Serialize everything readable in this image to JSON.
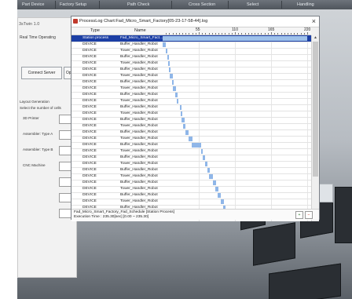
{
  "topbar": {
    "tabs": [
      "Part Device",
      "Factory Setup",
      "Path Check",
      "Cross Section",
      "Select",
      "Handling"
    ]
  },
  "left_panel": {
    "title": "3sTwin 1.0",
    "section_realtime": "Real Time Operating",
    "connect_button": "Connect Server",
    "open_button": "Open",
    "section_layout": "Layout Generation",
    "select_cells": "Select the number of cells",
    "cells": [
      {
        "label": "3D Printer"
      },
      {
        "label": "Assembler: Type A"
      },
      {
        "label": "Assembler: Type B"
      },
      {
        "label": "CNC Machine"
      }
    ]
  },
  "window": {
    "title": "ProcessLog Chart:Fad_Micro_Smart_Factory[05-23-17-58-44].log",
    "close": "×",
    "col_type": "Type",
    "col_name": "Name",
    "ticks": [
      "55",
      "110",
      "165",
      "220"
    ],
    "rows": [
      {
        "type": "Station process",
        "name": "Fad_Micro_Smart_Fact...",
        "selected": true,
        "start": 0,
        "dur": 220
      },
      {
        "type": "DEVICE",
        "name": "Buffer_Handler_Robot",
        "start": 0,
        "dur": 5
      },
      {
        "type": "DEVICE",
        "name": "Tower_Handler_Robot",
        "start": 5,
        "dur": 2
      },
      {
        "type": "DEVICE",
        "name": "Buffer_Handler_Robot",
        "start": 7,
        "dur": 2
      },
      {
        "type": "DEVICE",
        "name": "Tower_Handler_Robot",
        "start": 8,
        "dur": 2
      },
      {
        "type": "DEVICE",
        "name": "Buffer_Handler_Robot",
        "start": 10,
        "dur": 2
      },
      {
        "type": "DEVICE",
        "name": "Tower_Handler_Robot",
        "start": 11,
        "dur": 4
      },
      {
        "type": "DEVICE",
        "name": "Buffer_Handler_Robot",
        "start": 14,
        "dur": 2
      },
      {
        "type": "DEVICE",
        "name": "Tower_Handler_Robot",
        "start": 16,
        "dur": 4
      },
      {
        "type": "DEVICE",
        "name": "Buffer_Handler_Robot",
        "start": 19,
        "dur": 4
      },
      {
        "type": "DEVICE",
        "name": "Tower_Handler_Robot",
        "start": 22,
        "dur": 1
      },
      {
        "type": "DEVICE",
        "name": "Buffer_Handler_Robot",
        "start": 26,
        "dur": 1
      },
      {
        "type": "DEVICE",
        "name": "Tower_Handler_Robot",
        "start": 27,
        "dur": 3
      },
      {
        "type": "DEVICE",
        "name": "Buffer_Handler_Robot",
        "start": 29,
        "dur": 4
      },
      {
        "type": "DEVICE",
        "name": "Tower_Handler_Robot",
        "start": 31,
        "dur": 4
      },
      {
        "type": "DEVICE",
        "name": "Buffer_Handler_Robot",
        "start": 35,
        "dur": 5
      },
      {
        "type": "DEVICE",
        "name": "Tower_Handler_Robot",
        "start": 40,
        "dur": 5
      },
      {
        "type": "DEVICE",
        "name": "Buffer_Handler_Robot",
        "start": 44,
        "dur": 15
      },
      {
        "type": "DEVICE",
        "name": "Tower_Handler_Robot",
        "start": 59,
        "dur": 2
      },
      {
        "type": "DEVICE",
        "name": "Buffer_Handler_Robot",
        "start": 61,
        "dur": 4
      },
      {
        "type": "DEVICE",
        "name": "Tower_Handler_Robot",
        "start": 64,
        "dur": 4
      },
      {
        "type": "DEVICE",
        "name": "Buffer_Handler_Robot",
        "start": 68,
        "dur": 4
      },
      {
        "type": "DEVICE",
        "name": "Tower_Handler_Robot",
        "start": 71,
        "dur": 5
      },
      {
        "type": "DEVICE",
        "name": "Buffer_Handler_Robot",
        "start": 76,
        "dur": 5
      },
      {
        "type": "DEVICE",
        "name": "Tower_Handler_Robot",
        "start": 80,
        "dur": 5
      },
      {
        "type": "DEVICE",
        "name": "Buffer_Handler_Robot",
        "start": 84,
        "dur": 5
      },
      {
        "type": "DEVICE",
        "name": "Tower_Handler_Robot",
        "start": 89,
        "dur": 4
      },
      {
        "type": "DEVICE",
        "name": "Buffer_Handler_Robot",
        "start": 92,
        "dur": 4
      },
      {
        "type": "DEVICE",
        "name": "Tower_Handler_Robot",
        "start": 96,
        "dur": 4
      }
    ],
    "status_line1": "Fad_Micro_Smart_Factory_Fad_Schedule [Station Process]",
    "status_line2": "Execution Time : 235.30[sec] [0.00 ~ 235.30]"
  },
  "colors": {
    "selection": "#1c3fa5",
    "bar": "#8fb6e8"
  }
}
